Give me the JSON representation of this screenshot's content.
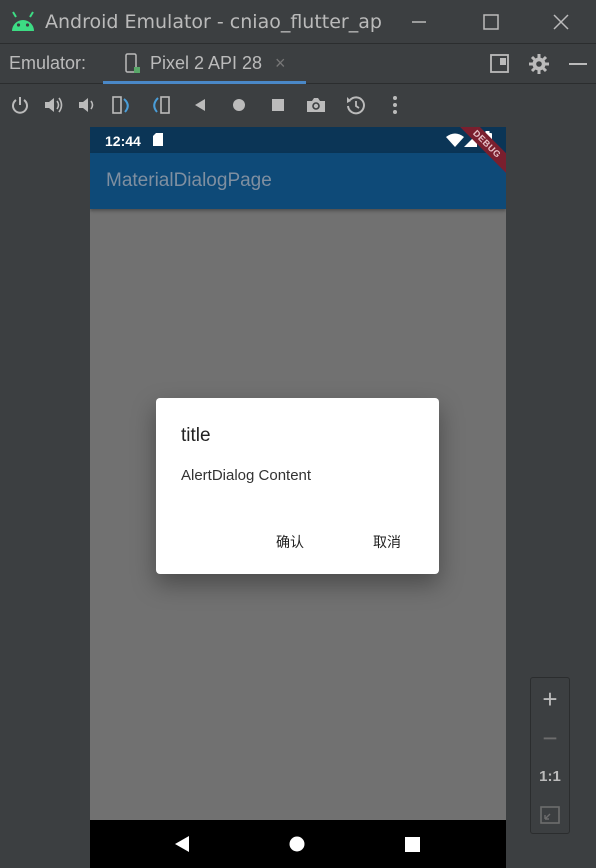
{
  "window": {
    "title": "Android Emulator - cniao_flutter_app_r"
  },
  "tabbar": {
    "label": "Emulator:",
    "tab_label": "Pixel 2 API 28",
    "tab_close": "×"
  },
  "phone": {
    "status_time": "12:44",
    "app_title": "MaterialDialogPage",
    "debug_label": "DEBUG",
    "dialog": {
      "title": "title",
      "content": "AlertDialog Content",
      "confirm_label": "确认",
      "cancel_label": "取消"
    }
  },
  "zoom": {
    "plus": "+",
    "minus": "−",
    "one_to_one": "1:1"
  },
  "colors": {
    "app_bar": "#0e4a78",
    "status_bar": "#0b3556",
    "scrim": "#717171",
    "tab_underline": "#4a88c7"
  }
}
